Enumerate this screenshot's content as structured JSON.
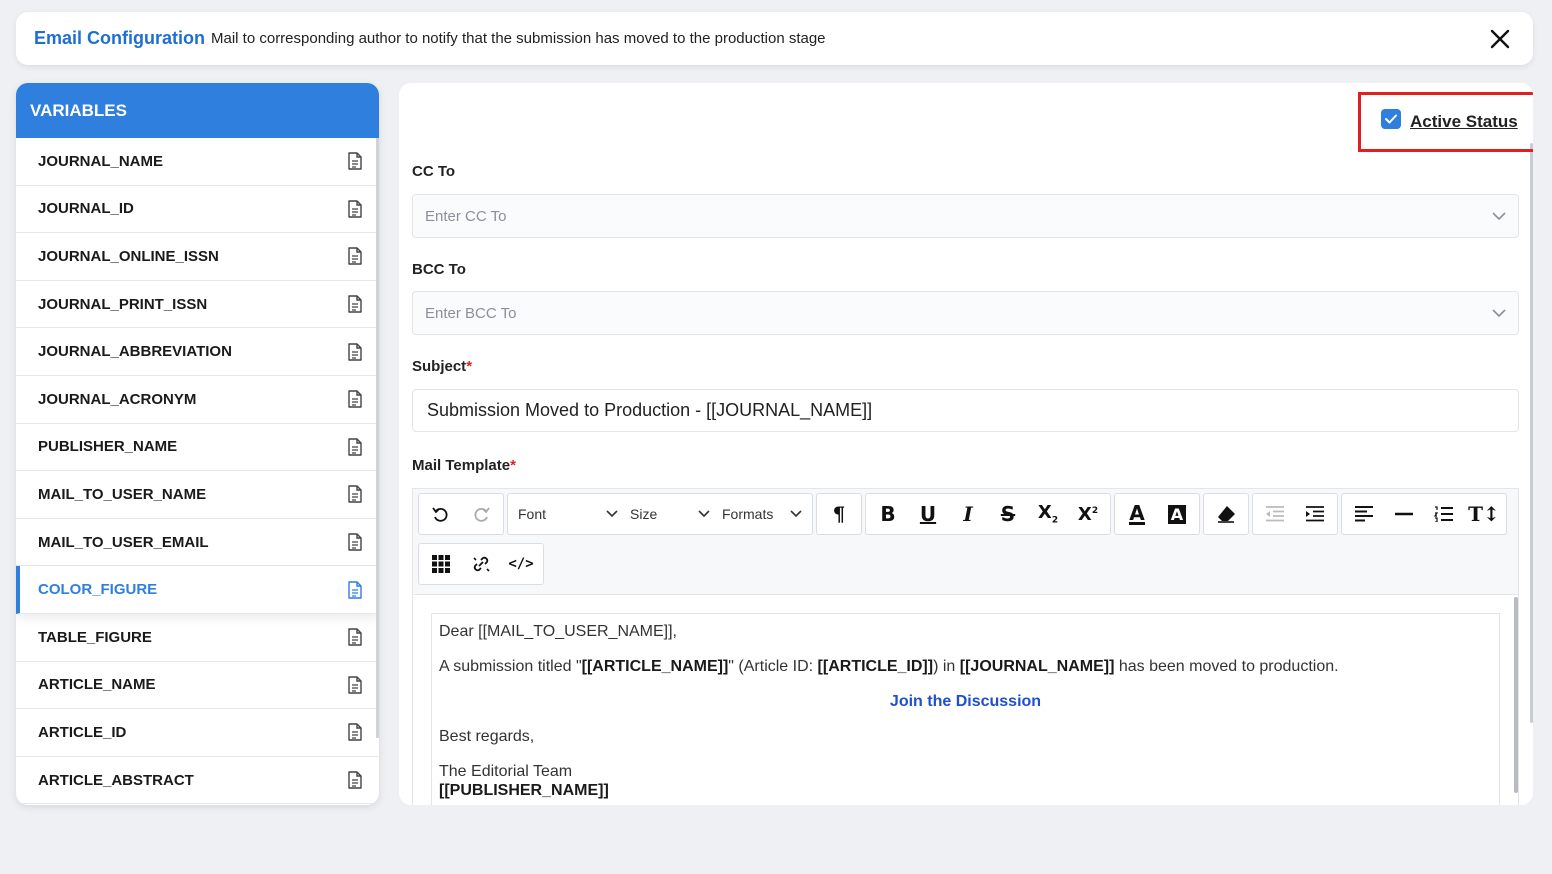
{
  "header": {
    "title": "Email Configuration",
    "description": "Mail to corresponding author to notify that the submission has moved to the production stage"
  },
  "sidebar": {
    "heading": "VARIABLES",
    "items": [
      {
        "label": "JOURNAL_NAME"
      },
      {
        "label": "JOURNAL_ID"
      },
      {
        "label": "JOURNAL_ONLINE_ISSN"
      },
      {
        "label": "JOURNAL_PRINT_ISSN"
      },
      {
        "label": "JOURNAL_ABBREVIATION"
      },
      {
        "label": "JOURNAL_ACRONYM"
      },
      {
        "label": "PUBLISHER_NAME"
      },
      {
        "label": "MAIL_TO_USER_NAME"
      },
      {
        "label": "MAIL_TO_USER_EMAIL"
      },
      {
        "label": "COLOR_FIGURE"
      },
      {
        "label": "TABLE_FIGURE"
      },
      {
        "label": "ARTICLE_NAME"
      },
      {
        "label": "ARTICLE_ID"
      },
      {
        "label": "ARTICLE_ABSTRACT"
      }
    ],
    "active_item": "COLOR_FIGURE"
  },
  "form": {
    "active_status_label": "Active Status",
    "active_status_checked": true,
    "cc_label": "CC To",
    "cc_placeholder": "Enter CC To",
    "bcc_label": "BCC To",
    "bcc_placeholder": "Enter BCC To",
    "subject_label": "Subject",
    "subject_value": "Submission Moved to Production - [[JOURNAL_NAME]]",
    "mail_template_label": "Mail Template",
    "required_mark": "*"
  },
  "toolbar": {
    "font_label": "Font",
    "size_label": "Size",
    "formats_label": "Formats"
  },
  "template_body": {
    "greeting": "Dear [[MAIL_TO_USER_NAME]],",
    "line1_a": "A submission titled \"",
    "line1_article": "[[ARTICLE_NAME]]",
    "line1_b": "\" (Article ID: ",
    "line1_id": "[[ARTICLE_ID]]",
    "line1_c": ") in ",
    "line1_journal": "[[JOURNAL_NAME]]",
    "line1_d": " has been moved to production.",
    "link": "Join the Discussion",
    "regards": "Best regards,",
    "team": "The Editorial Team",
    "publisher": "[[PUBLISHER_NAME]]"
  },
  "colors": {
    "accent": "#2e7fde",
    "highlight_border": "#e02020"
  }
}
